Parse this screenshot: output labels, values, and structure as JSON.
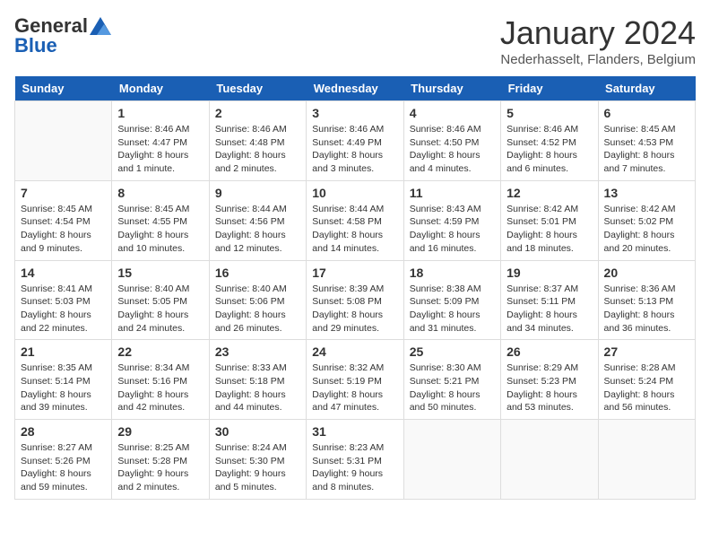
{
  "header": {
    "logo": {
      "general": "General",
      "blue": "Blue"
    },
    "title": "January 2024",
    "location": "Nederhasselt, Flanders, Belgium"
  },
  "weekdays": [
    "Sunday",
    "Monday",
    "Tuesday",
    "Wednesday",
    "Thursday",
    "Friday",
    "Saturday"
  ],
  "weeks": [
    [
      {
        "day": "",
        "sunrise": "",
        "sunset": "",
        "daylight": ""
      },
      {
        "day": "1",
        "sunrise": "Sunrise: 8:46 AM",
        "sunset": "Sunset: 4:47 PM",
        "daylight": "Daylight: 8 hours and 1 minute."
      },
      {
        "day": "2",
        "sunrise": "Sunrise: 8:46 AM",
        "sunset": "Sunset: 4:48 PM",
        "daylight": "Daylight: 8 hours and 2 minutes."
      },
      {
        "day": "3",
        "sunrise": "Sunrise: 8:46 AM",
        "sunset": "Sunset: 4:49 PM",
        "daylight": "Daylight: 8 hours and 3 minutes."
      },
      {
        "day": "4",
        "sunrise": "Sunrise: 8:46 AM",
        "sunset": "Sunset: 4:50 PM",
        "daylight": "Daylight: 8 hours and 4 minutes."
      },
      {
        "day": "5",
        "sunrise": "Sunrise: 8:46 AM",
        "sunset": "Sunset: 4:52 PM",
        "daylight": "Daylight: 8 hours and 6 minutes."
      },
      {
        "day": "6",
        "sunrise": "Sunrise: 8:45 AM",
        "sunset": "Sunset: 4:53 PM",
        "daylight": "Daylight: 8 hours and 7 minutes."
      }
    ],
    [
      {
        "day": "7",
        "sunrise": "Sunrise: 8:45 AM",
        "sunset": "Sunset: 4:54 PM",
        "daylight": "Daylight: 8 hours and 9 minutes."
      },
      {
        "day": "8",
        "sunrise": "Sunrise: 8:45 AM",
        "sunset": "Sunset: 4:55 PM",
        "daylight": "Daylight: 8 hours and 10 minutes."
      },
      {
        "day": "9",
        "sunrise": "Sunrise: 8:44 AM",
        "sunset": "Sunset: 4:56 PM",
        "daylight": "Daylight: 8 hours and 12 minutes."
      },
      {
        "day": "10",
        "sunrise": "Sunrise: 8:44 AM",
        "sunset": "Sunset: 4:58 PM",
        "daylight": "Daylight: 8 hours and 14 minutes."
      },
      {
        "day": "11",
        "sunrise": "Sunrise: 8:43 AM",
        "sunset": "Sunset: 4:59 PM",
        "daylight": "Daylight: 8 hours and 16 minutes."
      },
      {
        "day": "12",
        "sunrise": "Sunrise: 8:42 AM",
        "sunset": "Sunset: 5:01 PM",
        "daylight": "Daylight: 8 hours and 18 minutes."
      },
      {
        "day": "13",
        "sunrise": "Sunrise: 8:42 AM",
        "sunset": "Sunset: 5:02 PM",
        "daylight": "Daylight: 8 hours and 20 minutes."
      }
    ],
    [
      {
        "day": "14",
        "sunrise": "Sunrise: 8:41 AM",
        "sunset": "Sunset: 5:03 PM",
        "daylight": "Daylight: 8 hours and 22 minutes."
      },
      {
        "day": "15",
        "sunrise": "Sunrise: 8:40 AM",
        "sunset": "Sunset: 5:05 PM",
        "daylight": "Daylight: 8 hours and 24 minutes."
      },
      {
        "day": "16",
        "sunrise": "Sunrise: 8:40 AM",
        "sunset": "Sunset: 5:06 PM",
        "daylight": "Daylight: 8 hours and 26 minutes."
      },
      {
        "day": "17",
        "sunrise": "Sunrise: 8:39 AM",
        "sunset": "Sunset: 5:08 PM",
        "daylight": "Daylight: 8 hours and 29 minutes."
      },
      {
        "day": "18",
        "sunrise": "Sunrise: 8:38 AM",
        "sunset": "Sunset: 5:09 PM",
        "daylight": "Daylight: 8 hours and 31 minutes."
      },
      {
        "day": "19",
        "sunrise": "Sunrise: 8:37 AM",
        "sunset": "Sunset: 5:11 PM",
        "daylight": "Daylight: 8 hours and 34 minutes."
      },
      {
        "day": "20",
        "sunrise": "Sunrise: 8:36 AM",
        "sunset": "Sunset: 5:13 PM",
        "daylight": "Daylight: 8 hours and 36 minutes."
      }
    ],
    [
      {
        "day": "21",
        "sunrise": "Sunrise: 8:35 AM",
        "sunset": "Sunset: 5:14 PM",
        "daylight": "Daylight: 8 hours and 39 minutes."
      },
      {
        "day": "22",
        "sunrise": "Sunrise: 8:34 AM",
        "sunset": "Sunset: 5:16 PM",
        "daylight": "Daylight: 8 hours and 42 minutes."
      },
      {
        "day": "23",
        "sunrise": "Sunrise: 8:33 AM",
        "sunset": "Sunset: 5:18 PM",
        "daylight": "Daylight: 8 hours and 44 minutes."
      },
      {
        "day": "24",
        "sunrise": "Sunrise: 8:32 AM",
        "sunset": "Sunset: 5:19 PM",
        "daylight": "Daylight: 8 hours and 47 minutes."
      },
      {
        "day": "25",
        "sunrise": "Sunrise: 8:30 AM",
        "sunset": "Sunset: 5:21 PM",
        "daylight": "Daylight: 8 hours and 50 minutes."
      },
      {
        "day": "26",
        "sunrise": "Sunrise: 8:29 AM",
        "sunset": "Sunset: 5:23 PM",
        "daylight": "Daylight: 8 hours and 53 minutes."
      },
      {
        "day": "27",
        "sunrise": "Sunrise: 8:28 AM",
        "sunset": "Sunset: 5:24 PM",
        "daylight": "Daylight: 8 hours and 56 minutes."
      }
    ],
    [
      {
        "day": "28",
        "sunrise": "Sunrise: 8:27 AM",
        "sunset": "Sunset: 5:26 PM",
        "daylight": "Daylight: 8 hours and 59 minutes."
      },
      {
        "day": "29",
        "sunrise": "Sunrise: 8:25 AM",
        "sunset": "Sunset: 5:28 PM",
        "daylight": "Daylight: 9 hours and 2 minutes."
      },
      {
        "day": "30",
        "sunrise": "Sunrise: 8:24 AM",
        "sunset": "Sunset: 5:30 PM",
        "daylight": "Daylight: 9 hours and 5 minutes."
      },
      {
        "day": "31",
        "sunrise": "Sunrise: 8:23 AM",
        "sunset": "Sunset: 5:31 PM",
        "daylight": "Daylight: 9 hours and 8 minutes."
      },
      {
        "day": "",
        "sunrise": "",
        "sunset": "",
        "daylight": ""
      },
      {
        "day": "",
        "sunrise": "",
        "sunset": "",
        "daylight": ""
      },
      {
        "day": "",
        "sunrise": "",
        "sunset": "",
        "daylight": ""
      }
    ]
  ]
}
